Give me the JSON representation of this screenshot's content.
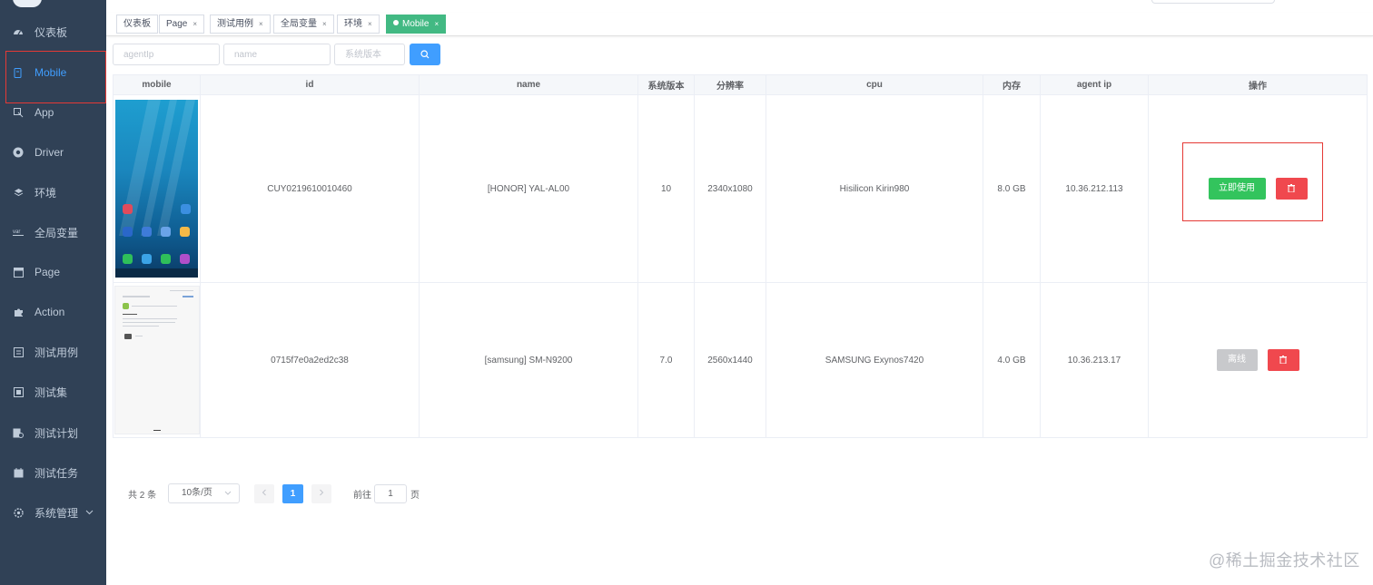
{
  "sidebar": {
    "items": [
      {
        "label": "仪表板",
        "icon": "dashboard-icon"
      },
      {
        "label": "Mobile",
        "icon": "mobile-icon",
        "active": true
      },
      {
        "label": "App",
        "icon": "app-icon"
      },
      {
        "label": "Driver",
        "icon": "chrome-icon"
      },
      {
        "label": "环境",
        "icon": "layers-icon"
      },
      {
        "label": "全局变量",
        "icon": "var-icon"
      },
      {
        "label": "Page",
        "icon": "page-icon"
      },
      {
        "label": "Action",
        "icon": "puzzle-icon"
      },
      {
        "label": "测试用例",
        "icon": "testcase-icon"
      },
      {
        "label": "测试集",
        "icon": "testsuite-icon"
      },
      {
        "label": "测试计划",
        "icon": "testplan-icon"
      },
      {
        "label": "测试任务",
        "icon": "task-icon"
      },
      {
        "label": "系统管理",
        "icon": "gear-icon"
      }
    ],
    "active_color": "#409eff",
    "background": "#304156"
  },
  "tags": [
    {
      "label": "仪表板"
    },
    {
      "label": "Page",
      "close": "×"
    },
    {
      "label": "测试用例",
      "close": "×"
    },
    {
      "label": "全局变量",
      "close": "×"
    },
    {
      "label": "环境",
      "close": "×"
    },
    {
      "label": "Mobile",
      "close": "×",
      "active": true
    }
  ],
  "filters": {
    "agent_ip_placeholder": "agentIp",
    "name_placeholder": "name",
    "system_version_placeholder": "系统版本",
    "search_icon": "search-icon"
  },
  "table": {
    "headers": [
      "mobile",
      "id",
      "name",
      "系统版本",
      "分辨率",
      "cpu",
      "内存",
      "agent ip",
      "操作"
    ],
    "rows": [
      {
        "id": "CUY0219610010460",
        "name": "[HONOR] YAL-AL00",
        "system_version": "10",
        "resolution": "2340x1080",
        "cpu": "Hisilicon Kirin980",
        "memory": "8.0 GB",
        "agent_ip": "10.36.212.113",
        "action_label": "立即使用",
        "action_state": "available"
      },
      {
        "id": "0715f7e0a2ed2c38",
        "name": "[samsung] SM-N9200",
        "system_version": "7.0",
        "resolution": "2560x1440",
        "cpu": "SAMSUNG Exynos7420",
        "memory": "4.0 GB",
        "agent_ip": "10.36.213.17",
        "action_label": "离线",
        "action_state": "offline"
      }
    ],
    "delete_icon": "trash-icon"
  },
  "pagination": {
    "total_text": "共 2 条",
    "page_size": "10条/页",
    "current_page": "1",
    "goto_label": "前往",
    "goto_value": "1",
    "page_suffix": "页"
  },
  "watermark": "@稀土掘金技术社区",
  "colors": {
    "primary": "#409eff",
    "success": "#33c45d",
    "danger": "#f0484e",
    "tag_active": "#42b983",
    "highlight_border": "#e53935"
  }
}
